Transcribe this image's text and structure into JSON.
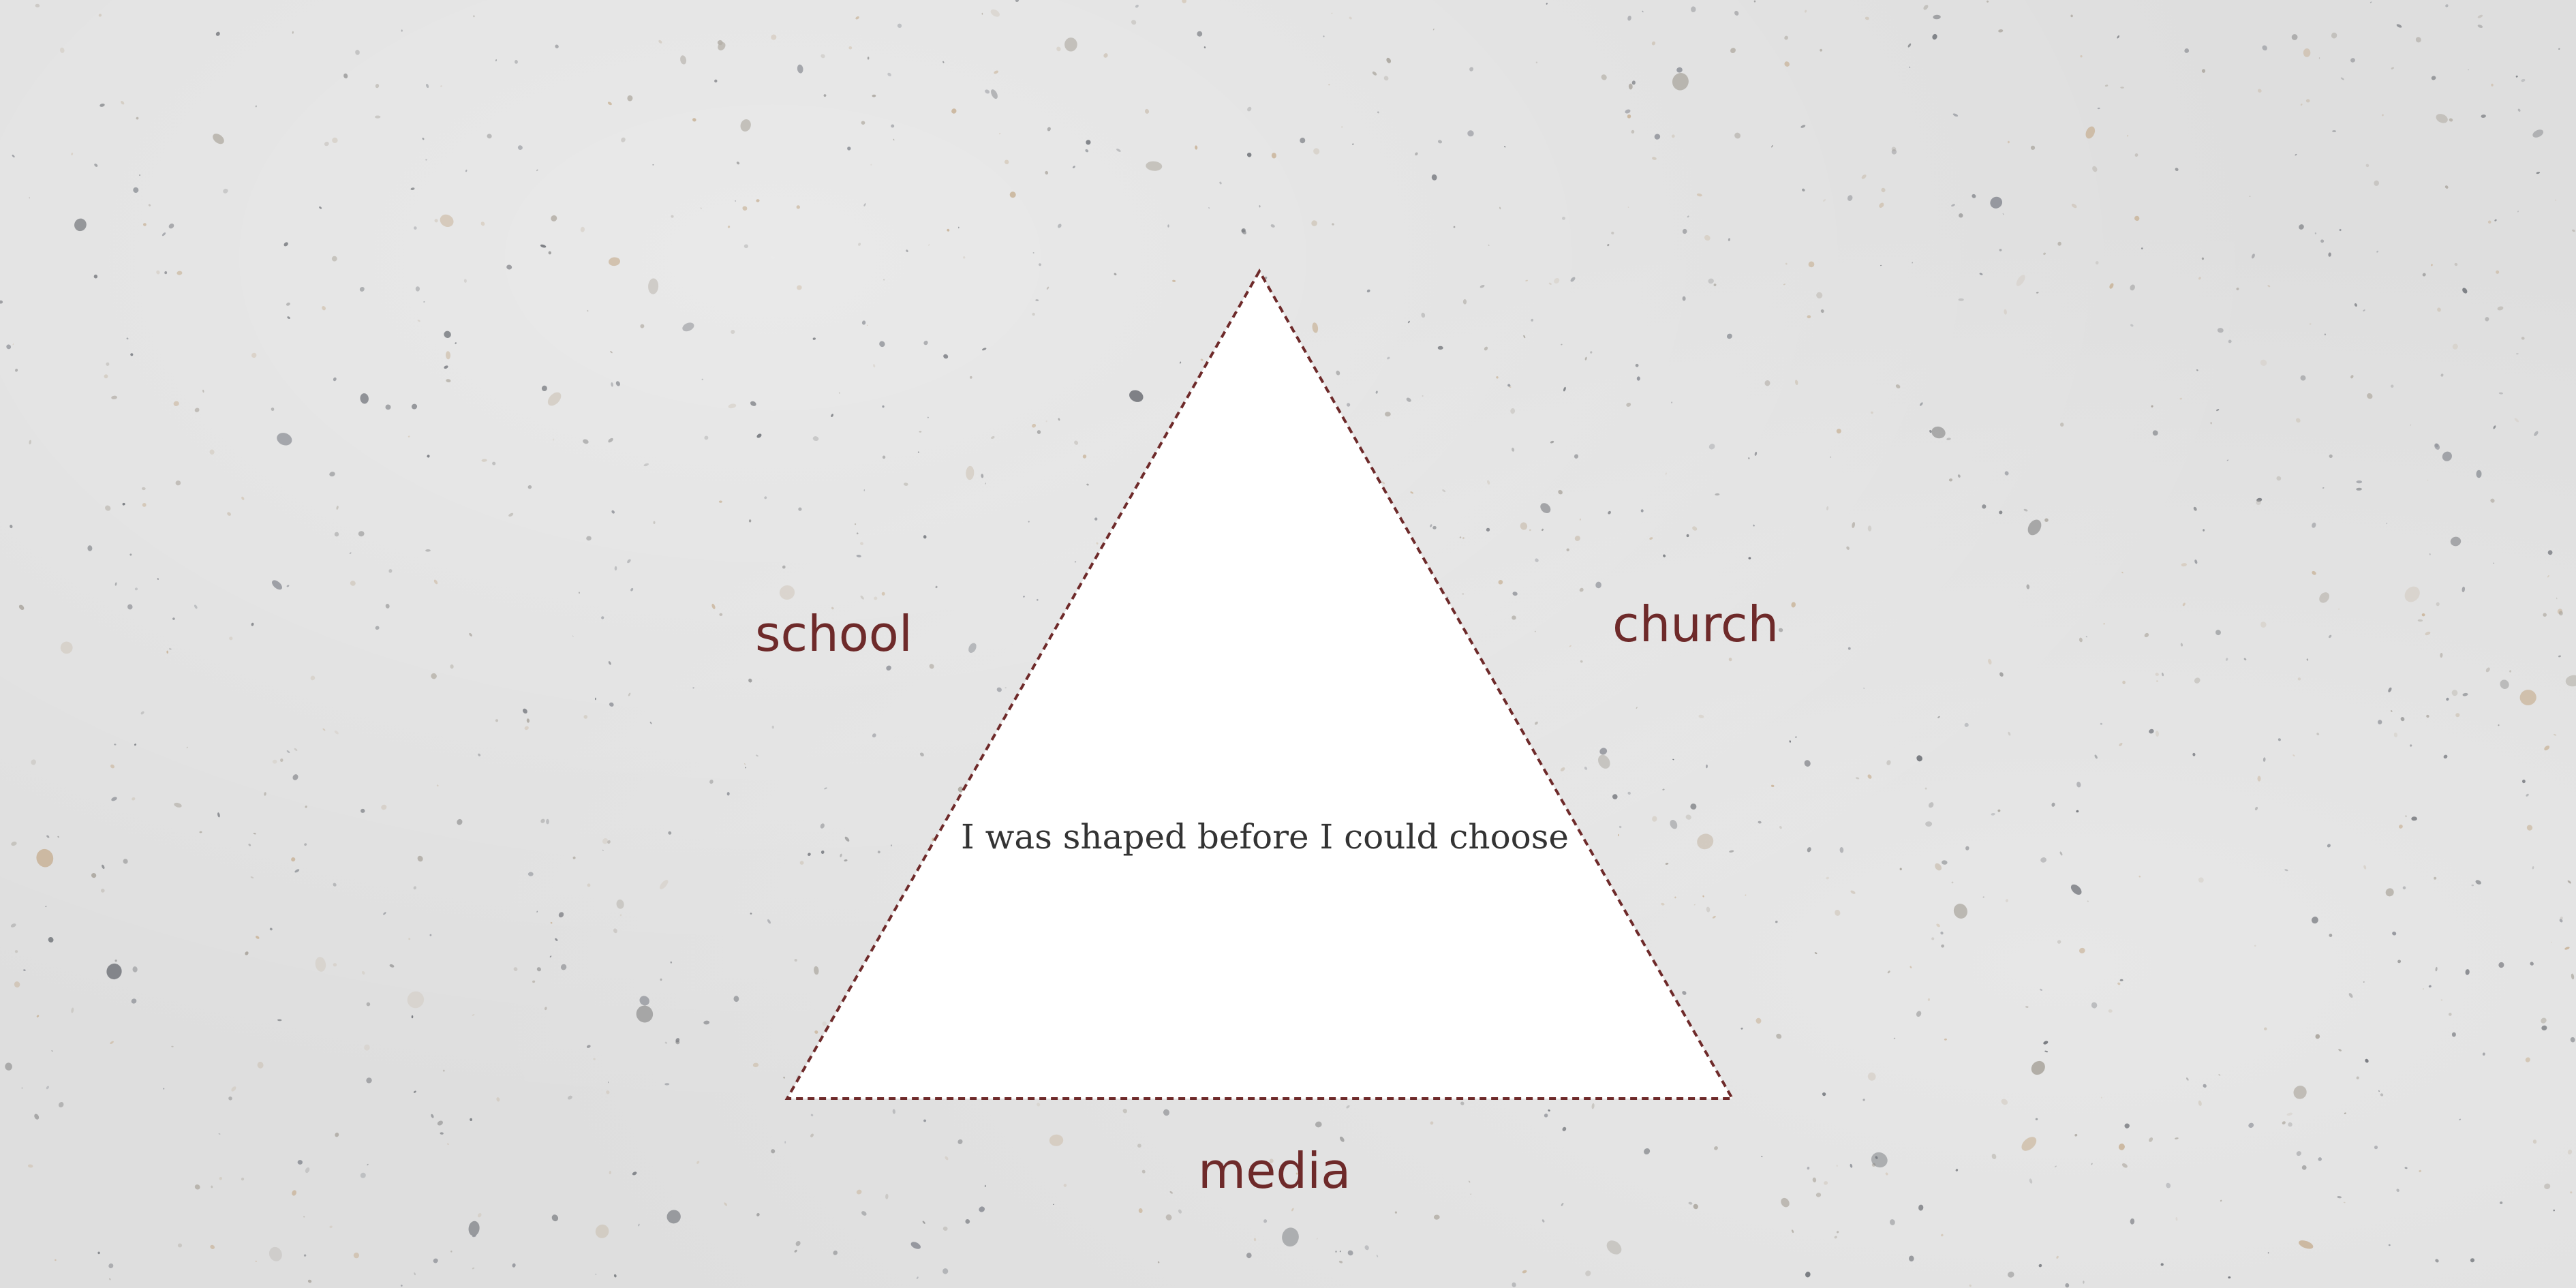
{
  "diagram": {
    "center_text": "I was shaped before I could choose",
    "sides": {
      "left": "school",
      "right": "church",
      "bottom": "media"
    },
    "colors": {
      "accent": "#6e2a2a",
      "background": "#dedede",
      "triangle_fill": "#ffffff",
      "center_text": "#333333"
    }
  }
}
